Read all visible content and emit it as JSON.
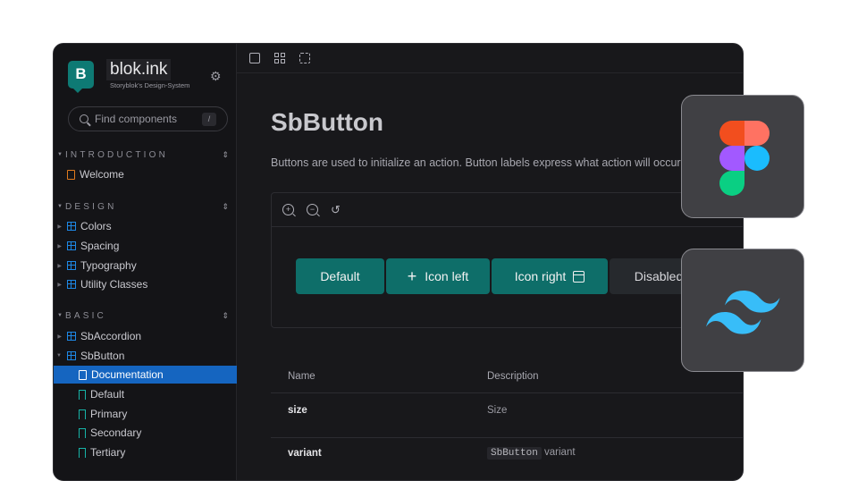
{
  "brand": {
    "name": "blok.ink",
    "subtitle": "Storyblok's Design-System",
    "logo_letter": "B"
  },
  "search": {
    "placeholder": "Find components",
    "shortcut": "/"
  },
  "sidebar": {
    "sections": [
      {
        "label": "INTRODUCTION",
        "items": [
          {
            "label": "Welcome",
            "icon": "doc"
          }
        ]
      },
      {
        "label": "DESIGN",
        "items": [
          {
            "label": "Colors",
            "icon": "grid"
          },
          {
            "label": "Spacing",
            "icon": "grid"
          },
          {
            "label": "Typography",
            "icon": "grid"
          },
          {
            "label": "Utility Classes",
            "icon": "grid"
          }
        ]
      },
      {
        "label": "BASIC",
        "items": [
          {
            "label": "SbAccordion",
            "icon": "grid"
          },
          {
            "label": "SbButton",
            "icon": "grid"
          }
        ]
      }
    ],
    "subitems": [
      {
        "label": "Documentation",
        "selected": true
      },
      {
        "label": "Default"
      },
      {
        "label": "Primary"
      },
      {
        "label": "Secondary"
      },
      {
        "label": "Tertiary"
      }
    ]
  },
  "page": {
    "title": "SbButton",
    "description": "Buttons are used to initialize an action. Button labels express what action will occur"
  },
  "buttons": {
    "default": "Default",
    "icon_left": "Icon left",
    "icon_right": "Icon right",
    "disabled": "Disabled"
  },
  "table": {
    "headers": {
      "name": "Name",
      "description": "Description"
    },
    "rows": [
      {
        "name": "size",
        "description": "Size"
      },
      {
        "name": "variant",
        "code": "SbButton",
        "description": "variant"
      }
    ]
  },
  "colors": {
    "accent": "#0e6e69",
    "selected": "#1565c0",
    "background": "#18181b"
  },
  "tiles": [
    "figma-logo-icon",
    "tailwind-logo-icon"
  ]
}
